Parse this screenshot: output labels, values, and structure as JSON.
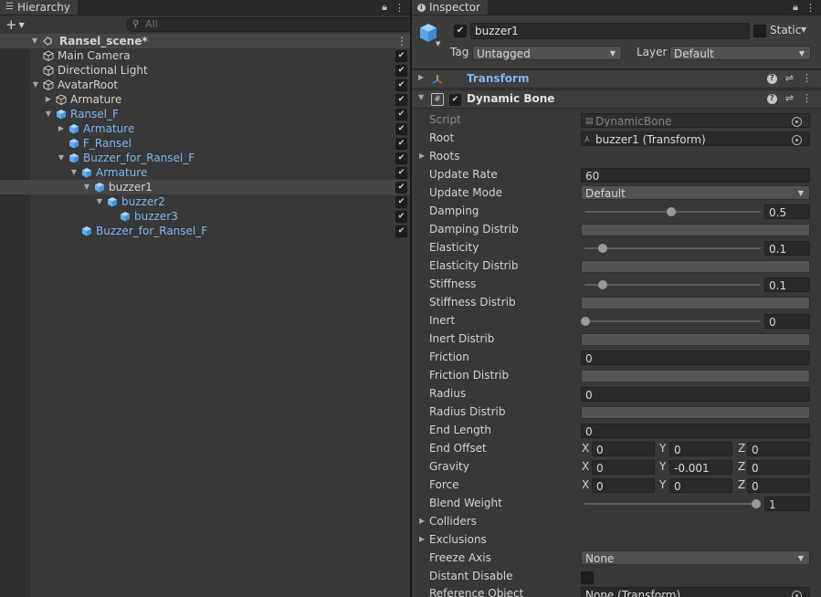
{
  "hierarchy": {
    "tab_label": "Hierarchy",
    "search_placeholder": "All",
    "scene_name": "Ransel_scene*",
    "rows": [
      {
        "label": "Main Camera",
        "indent": 1,
        "fold": "",
        "icon": "gameobject-icon",
        "blue": false
      },
      {
        "label": "Directional Light",
        "indent": 1,
        "fold": "",
        "icon": "gameobject-icon",
        "blue": false
      },
      {
        "label": "AvatarRoot",
        "indent": 1,
        "fold": "expanded",
        "icon": "gameobject-icon",
        "blue": false
      },
      {
        "label": "Armature",
        "indent": 2,
        "fold": "collapsed",
        "icon": "gameobject-icon",
        "blue": false
      },
      {
        "label": "Ransel_F",
        "indent": 2,
        "fold": "expanded",
        "icon": "prefab-icon",
        "blue": true
      },
      {
        "label": "Armature",
        "indent": 3,
        "fold": "collapsed",
        "icon": "prefab-icon",
        "blue": true
      },
      {
        "label": "F_Ransel",
        "indent": 3,
        "fold": "",
        "icon": "prefab-icon",
        "blue": true
      },
      {
        "label": "Buzzer_for_Ransel_F",
        "indent": 3,
        "fold": "expanded",
        "icon": "prefab-icon",
        "blue": true
      },
      {
        "label": "Armature",
        "indent": 4,
        "fold": "expanded",
        "icon": "prefab-icon",
        "blue": true
      },
      {
        "label": "buzzer1",
        "indent": 5,
        "fold": "expanded",
        "icon": "prefab-icon",
        "blue": false,
        "selected": true
      },
      {
        "label": "buzzer2",
        "indent": 6,
        "fold": "expanded",
        "icon": "prefab-icon",
        "blue": true
      },
      {
        "label": "buzzer3",
        "indent": 7,
        "fold": "",
        "icon": "prefab-icon",
        "blue": true
      },
      {
        "label": "Buzzer_for_Ransel_F",
        "indent": 4,
        "fold": "",
        "icon": "prefab-icon",
        "blue": true
      }
    ]
  },
  "inspector": {
    "tab_label": "Inspector",
    "object_name": "buzzer1",
    "static_label": "Static",
    "tag_label": "Tag",
    "tag_value": "Untagged",
    "layer_label": "Layer",
    "layer_value": "Default",
    "transform_title": "Transform",
    "component_title": "Dynamic Bone",
    "props": {
      "script_label": "Script",
      "script_value": "DynamicBone",
      "root_label": "Root",
      "root_value": "buzzer1 (Transform)",
      "roots_label": "Roots",
      "update_rate_label": "Update Rate",
      "update_rate_value": "60",
      "update_mode_label": "Update Mode",
      "update_mode_value": "Default",
      "damping_label": "Damping",
      "damping_value": "0.5",
      "damping_distrib_label": "Damping Distrib",
      "elasticity_label": "Elasticity",
      "elasticity_value": "0.1",
      "elasticity_distrib_label": "Elasticity Distrib",
      "stiffness_label": "Stiffness",
      "stiffness_value": "0.1",
      "stiffness_distrib_label": "Stiffness Distrib",
      "inert_label": "Inert",
      "inert_value": "0",
      "inert_distrib_label": "Inert Distrib",
      "friction_label": "Friction",
      "friction_value": "0",
      "friction_distrib_label": "Friction Distrib",
      "radius_label": "Radius",
      "radius_value": "0",
      "radius_distrib_label": "Radius Distrib",
      "end_length_label": "End Length",
      "end_length_value": "0",
      "end_offset_label": "End Offset",
      "end_offset": {
        "x": "0",
        "y": "0",
        "z": "0"
      },
      "gravity_label": "Gravity",
      "gravity": {
        "x": "0",
        "y": "-0.001",
        "z": "0"
      },
      "force_label": "Force",
      "force": {
        "x": "0",
        "y": "0",
        "z": "0"
      },
      "blend_weight_label": "Blend Weight",
      "blend_weight_value": "1",
      "colliders_label": "Colliders",
      "exclusions_label": "Exclusions",
      "freeze_axis_label": "Freeze Axis",
      "freeze_axis_value": "None",
      "distant_disable_label": "Distant Disable",
      "reference_object_label": "Reference Object",
      "reference_object_value": "None (Transform)"
    },
    "axis_x": "X",
    "axis_y": "Y",
    "axis_z": "Z"
  }
}
